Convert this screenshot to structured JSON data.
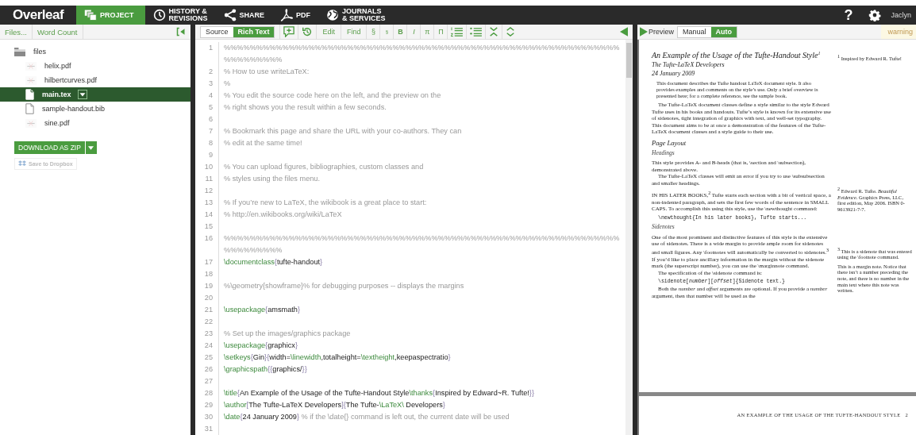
{
  "header": {
    "logo": "Overleaf",
    "nav": [
      {
        "label": "PROJECT",
        "kind": "project",
        "selected": true
      },
      {
        "label": "HISTORY &\nREVISIONS",
        "kind": "history",
        "selected": false
      },
      {
        "label": "SHARE",
        "kind": "share",
        "selected": false
      },
      {
        "label": "PDF",
        "kind": "pdf",
        "selected": false
      },
      {
        "label": "JOURNALS\n& SERVICES",
        "kind": "journals",
        "selected": false
      }
    ],
    "help": "?",
    "user": "Jaclyn"
  },
  "sidebar": {
    "toolbar": [
      "Files...",
      "Word Count"
    ],
    "tree": {
      "name": "files",
      "children": [
        {
          "name": "helix.pdf",
          "kind": "pdf",
          "selected": false
        },
        {
          "name": "hilbertcurves.pdf",
          "kind": "pdf",
          "selected": false
        },
        {
          "name": "main.tex",
          "kind": "file",
          "selected": true
        },
        {
          "name": "sample-handout.bib",
          "kind": "file",
          "selected": false
        },
        {
          "name": "sine.pdf",
          "kind": "pdf",
          "selected": false
        }
      ]
    },
    "download": "DOWNLOAD AS ZIP",
    "dropbox": {
      "label": "Save to Dropbox",
      "disabled": true
    }
  },
  "editor": {
    "modes": [
      {
        "label": "Source",
        "selected": false
      },
      {
        "label": "Rich Text",
        "selected": true
      }
    ],
    "edit": "Edit",
    "find": "Find",
    "format": [
      {
        "label": "§",
        "kind": "section"
      },
      {
        "label": "§",
        "kind": "subsection"
      },
      {
        "label": "B",
        "kind": "bold"
      },
      {
        "label": "I",
        "kind": "italic"
      },
      {
        "label": "π",
        "kind": "math"
      },
      {
        "label": "Π",
        "kind": "display"
      }
    ],
    "lines": [
      {
        "num": "1",
        "kind": "comment",
        "text": "%%%%%%%%%%%%%%%%%%%%%%%%%%%%%%%%%%%%%%%%%%%%%%%%%%%%%%%%%%%%%%%%%%%%%%"
      },
      {
        "num": "2",
        "kind": "comment",
        "text": "% How to use writeLaTeX:"
      },
      {
        "num": "3",
        "kind": "comment",
        "text": "%"
      },
      {
        "num": "4",
        "kind": "comment",
        "text": "% You edit the source code here on the left, and the preview on the"
      },
      {
        "num": "5",
        "kind": "comment",
        "text": "% right shows you the result within a few seconds."
      },
      {
        "num": "6",
        "kind": "blank"
      },
      {
        "num": "7",
        "kind": "comment",
        "text": "% Bookmark this page and share the URL with your co-authors. They can"
      },
      {
        "num": "8",
        "kind": "comment",
        "text": "% edit at the same time!"
      },
      {
        "num": "9",
        "kind": "blank"
      },
      {
        "num": "10",
        "kind": "comment",
        "text": "% You can upload figures, bibliographies, custom classes and"
      },
      {
        "num": "11",
        "kind": "comment",
        "text": "% styles using the files menu."
      },
      {
        "num": "12",
        "kind": "blank"
      },
      {
        "num": "13",
        "kind": "comment",
        "text": "% If you’re new to LaTeX, the wikibook is a great place to start:"
      },
      {
        "num": "14",
        "kind": "comment",
        "text": "% http://en.wikibooks.org/wiki/LaTeX"
      },
      {
        "num": "15",
        "kind": "blank"
      },
      {
        "num": "16",
        "kind": "comment",
        "text": "%%%%%%%%%%%%%%%%%%%%%%%%%%%%%%%%%%%%%%%%%%%%%%%%%%%%%%%%%%%%%%%%%%%%%%"
      },
      {
        "num": "17",
        "kind": "code",
        "text": "\\documentclass{tufte-handout}"
      },
      {
        "num": "18",
        "kind": "blank"
      },
      {
        "num": "19",
        "kind": "comment",
        "text": "%\\geometry{showframe}% for debugging purposes -- displays the margins"
      },
      {
        "num": "20",
        "kind": "blank"
      },
      {
        "num": "21",
        "kind": "code",
        "text": "\\usepackage{amsmath}"
      },
      {
        "num": "22",
        "kind": "blank"
      },
      {
        "num": "23",
        "kind": "comment",
        "text": "% Set up the images/graphics package"
      },
      {
        "num": "24",
        "kind": "code",
        "text": "\\usepackage{graphicx}"
      },
      {
        "num": "25",
        "kind": "code",
        "text": "\\setkeys{Gin}{width=\\linewidth,totalheight=\\textheight,keepaspectratio}"
      },
      {
        "num": "26",
        "kind": "code",
        "text": "\\graphicspath{{graphics/}}"
      },
      {
        "num": "27",
        "kind": "blank"
      },
      {
        "num": "28",
        "kind": "code",
        "text": "\\title{An Example of the Usage of the Tufte-Handout Style\\thanks{Inspired by Edward~R. Tufte!}}"
      },
      {
        "num": "29",
        "kind": "code",
        "text": "\\author[The Tufte-LaTeX Developers]{The Tufte-\\LaTeX\\ Developers}"
      },
      {
        "num": "30",
        "kind": "code",
        "text": "\\date{24 January 2009}  % if the \\date{} command is left out, the current date will be used"
      },
      {
        "num": "31",
        "kind": "blank"
      }
    ]
  },
  "preview": {
    "label": "Preview",
    "modes": [
      {
        "label": "Manual",
        "selected": false
      },
      {
        "label": "Auto",
        "selected": true
      }
    ],
    "warning": "warning",
    "page": {
      "title": "An Example of the Usage of the Tufte-Handout Style$^{1}$",
      "author": "The Tufte-LaTeX Developers",
      "date": "24 January 2009",
      "rows": [
        {
          "blocks": [
            {
              "kind": "abstract",
              "text": "This document describes the Tufte handout LaTeX document style. It also provides examples and comments on the style’s use. Only a brief overview is presented here; for a complete reference, see the sample book."
            },
            {
              "kind": "para",
              "text": "The Tufte-LaTeX document classes define a style similar to the style Edward Tufte uses in his books and handouts. Tufte’s style is known for its extensive use of sidenotes, tight integration of graphics with text, and well-set typography. This document aims to be at once a demonstration of the features of the Tufte-LaTeX document classes and a style guide to their use."
            },
            {
              "kind": "section",
              "text": "Page Layout"
            },
            {
              "kind": "subsection",
              "text": "Headings"
            },
            {
              "kind": "first",
              "text": "This style provides A- and B-heads (that is, \\section and \\subsection), demonstrated above."
            },
            {
              "kind": "para",
              "text": "The Tufte-LaTeX classes will emit an error if you try to use \\subsubsection and smaller headings."
            }
          ],
          "notes": []
        },
        {
          "blocks": [
            {
              "kind": "first",
              "text": "IN HIS LATER BOOKS,$^{2}$ Tufte starts each section with a bit of vertical space, a non-indented paragraph, and sets the first few words of the sentence in SMALL CAPS. To accomplish this using this style, use the \\newthought command:"
            },
            {
              "kind": "code",
              "text": "\\newthought{In his later books}, Tufte starts..."
            },
            {
              "kind": "subsection",
              "text": "Sidenotes"
            }
          ],
          "notes": [
            "$^{2}$ Edward R. Tufte. *Beautiful Evidence*. Graphics Press, LLC, first edition, May 2006. ISBN 0-9613921-7-7."
          ]
        },
        {
          "blocks": [
            {
              "kind": "first",
              "text": "One of the most prominent and distinctive features of this style is the extensive use of sidenotes. There is a wide margin to provide ample room for sidenotes and small figures. Any \\footnotes will automatically be converted to sidenotes.$^{3}$ If you’d like to place ancillary information in the margin without the sidenote mark (the superscript number), you can use the \\marginnote command."
            },
            {
              "kind": "para",
              "text": "The specification of the \\sidenote command is:"
            },
            {
              "kind": "code",
              "text": "\\sidenote[*number*][*offset*]{Sidenote text.}"
            },
            {
              "kind": "para",
              "text": "Both the *number* and *offset* arguments are optional. If you provide a *number* argument, then that number will be used as the"
            }
          ],
          "notes": [
            "$^{3}$ This is a sidenote that was entered using the \\footnote command.",
            "This is a margin note. Notice that there isn’t a number preceding the note, and there is no number in the main text where this note was written."
          ]
        }
      ],
      "title_note": "$^{1}$ Inspired by Edward R. Tufte!"
    },
    "next_page": {
      "header": "AN EXAMPLE OF THE USAGE OF THE TUFTE-HANDOUT STYLE",
      "number": "2"
    }
  }
}
